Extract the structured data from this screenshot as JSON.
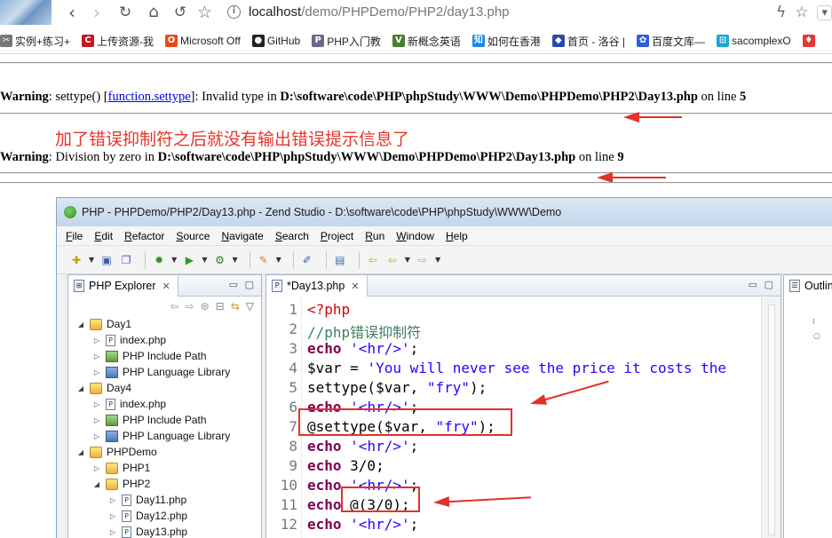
{
  "browser": {
    "url_host": "localhost",
    "url_path": "/demo/PHPDemo/PHP2/day13.php",
    "bookmarks": [
      {
        "label": "实例+练习+",
        "icon_color": "#777",
        "icon_glyph": "✂",
        "icon": "scissors-icon"
      },
      {
        "label": "上传资源-我",
        "icon_color": "#c8161d",
        "icon_glyph": "C",
        "icon": "csdn-icon"
      },
      {
        "label": "Microsoft Off",
        "icon_color": "#e64a19",
        "icon_glyph": "O",
        "icon": "office-icon"
      },
      {
        "label": "GitHub",
        "icon_color": "#222",
        "icon_glyph": "●",
        "icon": "github-icon"
      },
      {
        "label": "PHP入门教",
        "icon_color": "#6a6a8a",
        "icon_glyph": "P",
        "icon": "php-icon"
      },
      {
        "label": "新概念英语",
        "icon_color": "#4b7f2a",
        "icon_glyph": "V",
        "icon": "vocab-icon"
      },
      {
        "label": "如何在香港",
        "icon_color": "#1e88e5",
        "icon_glyph": "知",
        "icon": "zhihu-icon"
      },
      {
        "label": "首页 - 洛谷 |",
        "icon_color": "#2b4aa8",
        "icon_glyph": "◆",
        "icon": "luogu-icon"
      },
      {
        "label": "百度文库—",
        "icon_color": "#2d5fd8",
        "icon_glyph": "✿",
        "icon": "baidu-icon"
      },
      {
        "label": "sacomplexO",
        "icon_color": "#19a6d6",
        "icon_glyph": "⊡",
        "icon": "bilibili-icon"
      },
      {
        "label": "",
        "icon_color": "#e53935",
        "icon_glyph": "♦",
        "icon": "red-bookmark-icon"
      }
    ]
  },
  "page": {
    "warning1": {
      "label": "Warning",
      "pre": ": settype() [",
      "link": "function.settype",
      "mid": "]: Invalid type in ",
      "path": "D:\\software\\code\\PHP\\phpStudy\\WWW\\Demo\\PHPDemo\\PHP2\\Day13.php",
      "online": " on line ",
      "line": "5"
    },
    "annotation": "加了错误抑制符之后就没有输出错误提示信息了",
    "warning2": {
      "label": "Warning",
      "mid": ": Division by zero in ",
      "path": "D:\\software\\code\\PHP\\phpStudy\\WWW\\Demo\\PHPDemo\\PHP2\\Day13.php",
      "online": " on line ",
      "line": "9"
    },
    "annotation_color": "#e8342a"
  },
  "ide": {
    "title": "PHP - PHPDemo/PHP2/Day13.php - Zend Studio - D:\\software\\code\\PHP\\phpStudy\\WWW\\Demo",
    "menu": [
      "File",
      "Edit",
      "Refactor",
      "Source",
      "Navigate",
      "Search",
      "Project",
      "Run",
      "Window",
      "Help"
    ],
    "explorer": {
      "tab": "PHP Explorer",
      "tree": [
        {
          "label": "Day1",
          "depth": 0,
          "type": "folder",
          "twisty": "◢"
        },
        {
          "label": "index.php",
          "depth": 1,
          "type": "file",
          "twisty": "▷"
        },
        {
          "label": "PHP Include Path",
          "depth": 1,
          "type": "inc",
          "twisty": "▷"
        },
        {
          "label": "PHP Language Library",
          "depth": 1,
          "type": "lib",
          "twisty": "▷"
        },
        {
          "label": "Day4",
          "depth": 0,
          "type": "folder",
          "twisty": "◢"
        },
        {
          "label": "index.php",
          "depth": 1,
          "type": "file",
          "twisty": "▷"
        },
        {
          "label": "PHP Include Path",
          "depth": 1,
          "type": "inc",
          "twisty": "▷"
        },
        {
          "label": "PHP Language Library",
          "depth": 1,
          "type": "lib",
          "twisty": "▷"
        },
        {
          "label": "PHPDemo",
          "depth": 0,
          "type": "folder",
          "twisty": "◢"
        },
        {
          "label": "PHP1",
          "depth": 1,
          "type": "folder",
          "twisty": "▷"
        },
        {
          "label": "PHP2",
          "depth": 1,
          "type": "folder",
          "twisty": "◢"
        },
        {
          "label": "Day11.php",
          "depth": 2,
          "type": "file",
          "twisty": "▷"
        },
        {
          "label": "Day12.php",
          "depth": 2,
          "type": "file",
          "twisty": "▷"
        },
        {
          "label": "Day13.php",
          "depth": 2,
          "type": "file",
          "twisty": "▷"
        }
      ]
    },
    "editor": {
      "tab": "*Day13.php",
      "lines": [
        {
          "n": "1",
          "parts": [
            [
              "t",
              "<?php"
            ]
          ]
        },
        {
          "n": "2",
          "parts": [
            [
              "c",
              "//php错误抑制符"
            ]
          ]
        },
        {
          "n": "3",
          "parts": [
            [
              "k",
              "echo"
            ],
            [
              "v",
              " "
            ],
            [
              "s",
              "'<hr/>'"
            ],
            [
              "v",
              ";"
            ]
          ]
        },
        {
          "n": "4",
          "parts": [
            [
              "v",
              "$var = "
            ],
            [
              "s",
              "'You will never see the price it costs the"
            ]
          ]
        },
        {
          "n": "5",
          "parts": [
            [
              "v",
              "settype($var, "
            ],
            [
              "s",
              "\"fry\""
            ],
            [
              "v",
              ");"
            ]
          ]
        },
        {
          "n": "6",
          "parts": [
            [
              "k",
              "echo"
            ],
            [
              "v",
              " "
            ],
            [
              "s",
              "'<hr/>'"
            ],
            [
              "v",
              ";"
            ]
          ]
        },
        {
          "n": "7",
          "parts": [
            [
              "v",
              "@settype($var, "
            ],
            [
              "s",
              "\"fry\""
            ],
            [
              "v",
              ");"
            ]
          ]
        },
        {
          "n": "8",
          "parts": [
            [
              "k",
              "echo"
            ],
            [
              "v",
              " "
            ],
            [
              "s",
              "'<hr/>'"
            ],
            [
              "v",
              ";"
            ]
          ]
        },
        {
          "n": "9",
          "parts": [
            [
              "k",
              "echo"
            ],
            [
              "v",
              " 3/0;"
            ]
          ]
        },
        {
          "n": "10",
          "parts": [
            [
              "k",
              "echo"
            ],
            [
              "v",
              " "
            ],
            [
              "s",
              "'<hr/>'"
            ],
            [
              "v",
              ";"
            ]
          ]
        },
        {
          "n": "11",
          "parts": [
            [
              "k",
              "echo"
            ],
            [
              "v",
              " @(3/0);"
            ]
          ]
        },
        {
          "n": "12",
          "parts": [
            [
              "k",
              "echo"
            ],
            [
              "v",
              " "
            ],
            [
              "s",
              "'<hr/>'"
            ],
            [
              "v",
              ";"
            ]
          ]
        }
      ]
    },
    "outline": {
      "tab": "Outlin"
    }
  }
}
